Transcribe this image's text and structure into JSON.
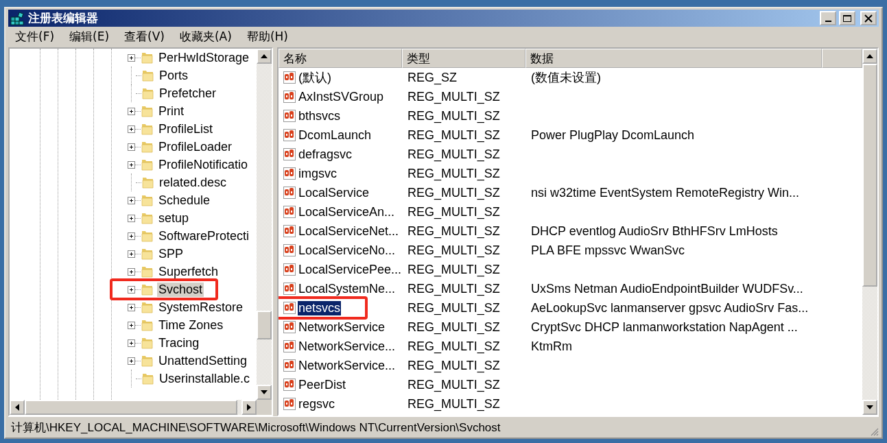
{
  "window": {
    "title": "注册表编辑器"
  },
  "menu": [
    "文件(F)",
    "编辑(E)",
    "查看(V)",
    "收藏夹(A)",
    "帮助(H)"
  ],
  "tree": {
    "items": [
      {
        "label": "PerHwIdStorage",
        "expandable": true,
        "selected": false
      },
      {
        "label": "Ports",
        "expandable": false,
        "selected": false
      },
      {
        "label": "Prefetcher",
        "expandable": false,
        "selected": false
      },
      {
        "label": "Print",
        "expandable": true,
        "selected": false
      },
      {
        "label": "ProfileList",
        "expandable": true,
        "selected": false
      },
      {
        "label": "ProfileLoader",
        "expandable": true,
        "selected": false
      },
      {
        "label": "ProfileNotificatio",
        "expandable": true,
        "selected": false
      },
      {
        "label": "related.desc",
        "expandable": false,
        "selected": false
      },
      {
        "label": "Schedule",
        "expandable": true,
        "selected": false
      },
      {
        "label": "setup",
        "expandable": true,
        "selected": false
      },
      {
        "label": "SoftwareProtecti",
        "expandable": true,
        "selected": false
      },
      {
        "label": "SPP",
        "expandable": true,
        "selected": false
      },
      {
        "label": "Superfetch",
        "expandable": true,
        "selected": false
      },
      {
        "label": "Svchost",
        "expandable": true,
        "selected": true,
        "annotated": true
      },
      {
        "label": "SystemRestore",
        "expandable": true,
        "selected": false
      },
      {
        "label": "Time Zones",
        "expandable": true,
        "selected": false
      },
      {
        "label": "Tracing",
        "expandable": true,
        "selected": false
      },
      {
        "label": "UnattendSetting",
        "expandable": true,
        "selected": false
      },
      {
        "label": "Userinstallable.c",
        "expandable": false,
        "selected": false
      }
    ]
  },
  "values": {
    "columns": [
      "名称",
      "类型",
      "数据"
    ],
    "rows": [
      {
        "name": "(默认)",
        "type": "REG_SZ",
        "data": "(数值未设置)",
        "selected": false
      },
      {
        "name": "AxInstSVGroup",
        "type": "REG_MULTI_SZ",
        "data": "",
        "selected": false
      },
      {
        "name": "bthsvcs",
        "type": "REG_MULTI_SZ",
        "data": "",
        "selected": false
      },
      {
        "name": "DcomLaunch",
        "type": "REG_MULTI_SZ",
        "data": "Power PlugPlay DcomLaunch",
        "selected": false
      },
      {
        "name": "defragsvc",
        "type": "REG_MULTI_SZ",
        "data": "",
        "selected": false
      },
      {
        "name": "imgsvc",
        "type": "REG_MULTI_SZ",
        "data": "",
        "selected": false
      },
      {
        "name": "LocalService",
        "type": "REG_MULTI_SZ",
        "data": "nsi w32time EventSystem RemoteRegistry Win...",
        "selected": false
      },
      {
        "name": "LocalServiceAn...",
        "type": "REG_MULTI_SZ",
        "data": "",
        "selected": false
      },
      {
        "name": "LocalServiceNet...",
        "type": "REG_MULTI_SZ",
        "data": "DHCP eventlog AudioSrv BthHFSrv LmHosts",
        "selected": false
      },
      {
        "name": "LocalServiceNo...",
        "type": "REG_MULTI_SZ",
        "data": "PLA BFE mpssvc WwanSvc",
        "selected": false
      },
      {
        "name": "LocalServicePee...",
        "type": "REG_MULTI_SZ",
        "data": "",
        "selected": false
      },
      {
        "name": "LocalSystemNe...",
        "type": "REG_MULTI_SZ",
        "data": "UxSms Netman AudioEndpointBuilder WUDFSv...",
        "selected": false
      },
      {
        "name": "netsvcs",
        "type": "REG_MULTI_SZ",
        "data": "AeLookupSvc lanmanserver gpsvc AudioSrv Fas...",
        "selected": true,
        "annotated": true
      },
      {
        "name": "NetworkService",
        "type": "REG_MULTI_SZ",
        "data": "CryptSvc DHCP lanmanworkstation NapAgent ...",
        "selected": false
      },
      {
        "name": "NetworkService...",
        "type": "REG_MULTI_SZ",
        "data": "KtmRm",
        "selected": false
      },
      {
        "name": "NetworkService...",
        "type": "REG_MULTI_SZ",
        "data": "",
        "selected": false
      },
      {
        "name": "PeerDist",
        "type": "REG_MULTI_SZ",
        "data": "",
        "selected": false
      },
      {
        "name": "regsvc",
        "type": "REG_MULTI_SZ",
        "data": "",
        "selected": false
      }
    ]
  },
  "status_bar": "计算机\\HKEY_LOCAL_MACHINE\\SOFTWARE\\Microsoft\\Windows NT\\CurrentVersion\\Svchost"
}
